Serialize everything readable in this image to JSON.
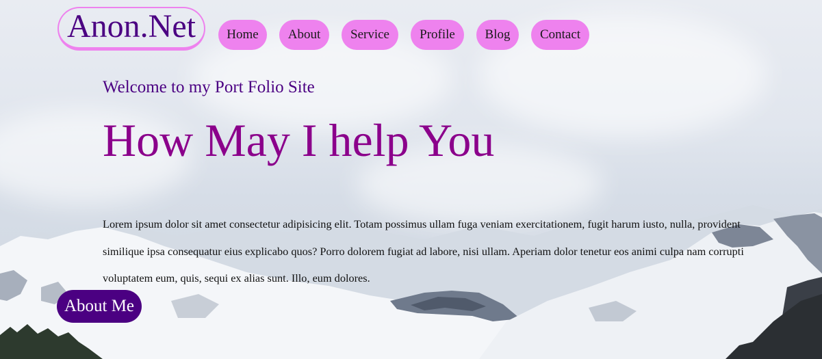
{
  "brand": {
    "name": "Anon.Net"
  },
  "nav": {
    "items": [
      {
        "label": "Home"
      },
      {
        "label": "About"
      },
      {
        "label": "Service"
      },
      {
        "label": "Profile"
      },
      {
        "label": "Blog"
      },
      {
        "label": "Contact"
      }
    ]
  },
  "hero": {
    "subtitle": "Welcome to my Port Folio Site",
    "headline": "How May I help You",
    "paragraph": "Lorem ipsum dolor sit amet consectetur adipisicing elit. Totam possimus ullam fuga veniam exercitationem, fugit harum iusto, nulla, provident similique ipsa consequatur eius explicabo quos? Porro dolorem fugiat ad labore, nisi ullam. Aperiam dolor tenetur eos animi culpa nam corrupti voluptatem eum, quis, sequi ex alias sunt. Illo, eum dolores.",
    "cta_label": "About Me"
  },
  "colors": {
    "nav_button": "#ee82ee",
    "logo_text": "#4b0082",
    "subtitle": "#4b0082",
    "headline": "#8b008b",
    "cta_background": "#4b0082"
  },
  "background": {
    "scene": "snowy-mountains-under-cloudy-sky"
  }
}
